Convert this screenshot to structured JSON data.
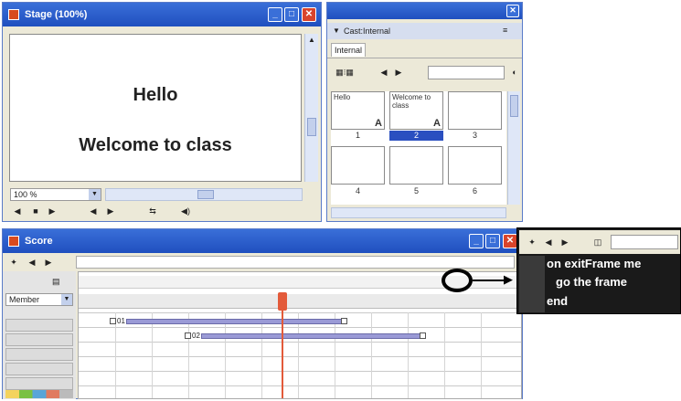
{
  "stage": {
    "title": "Stage (100%)",
    "line1": "Hello",
    "line2": "Welcome to class",
    "zoom": "100 %"
  },
  "cast": {
    "title": "Cast:Internal",
    "tab": "Internal",
    "members": [
      {
        "text": "Hello",
        "num": "1"
      },
      {
        "text": "Welcome to class",
        "num": "2"
      },
      {
        "text": "",
        "num": "3"
      },
      {
        "text": "",
        "num": "4"
      },
      {
        "text": "",
        "num": "5"
      },
      {
        "text": "",
        "num": "6"
      }
    ]
  },
  "score": {
    "title": "Score",
    "channel_dropdown": "Member",
    "sprite1_num": "01",
    "sprite2_num": "02"
  },
  "script": {
    "lines": [
      "on exitFrame me",
      "  go the frame",
      "end"
    ]
  },
  "colors": {
    "titlebar": "#1f4fbf",
    "close": "#d9442b",
    "selection": "#2a4fc0",
    "playhead": "#e35a3a",
    "sprite": "#9a9ad6",
    "script_bg": "#1a1a1a"
  }
}
